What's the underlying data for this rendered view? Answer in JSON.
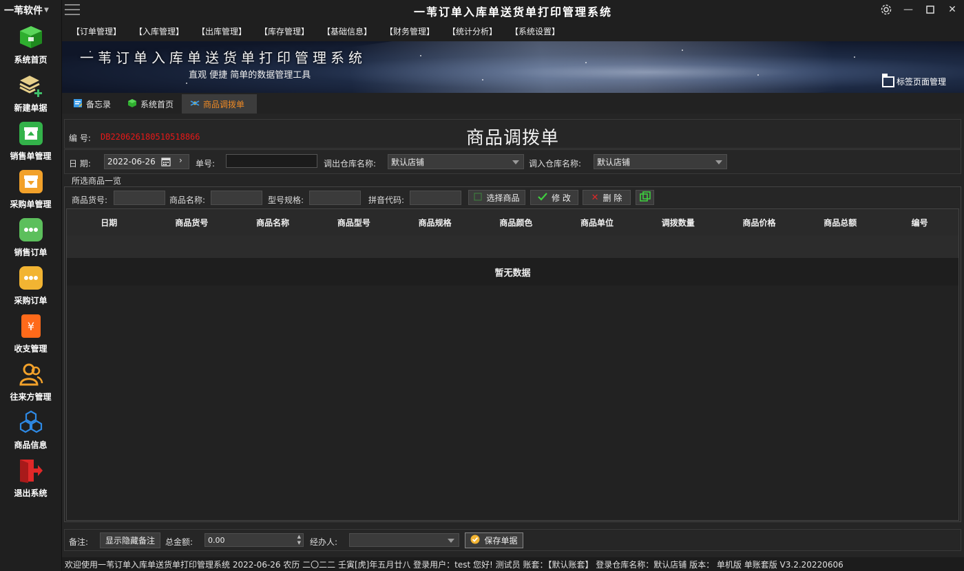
{
  "app": {
    "brand": "一苇软件",
    "title": "一苇订单入库单送货单打印管理系统"
  },
  "sidebar": {
    "items": [
      {
        "label": "系统首页",
        "icon": "green-box-icon",
        "color": "#3fbf3f"
      },
      {
        "label": "新建单据",
        "icon": "layers-plus-icon",
        "color": "#e0c070"
      },
      {
        "label": "销售单管理",
        "icon": "upload-box-icon",
        "color": "#3cb84a"
      },
      {
        "label": "采购单管理",
        "icon": "download-box-icon",
        "color": "#f0a020"
      },
      {
        "label": "销售订单",
        "icon": "chat-dots-icon",
        "color": "#5cc05c"
      },
      {
        "label": "采购订单",
        "icon": "chat-dots-icon",
        "color": "#f0b030"
      },
      {
        "label": "收支管理",
        "icon": "yen-icon",
        "color": "#ff6a1a"
      },
      {
        "label": "往来方管理",
        "icon": "users-icon",
        "color": "#f0a020"
      },
      {
        "label": "商品信息",
        "icon": "cubes-icon",
        "color": "#2e8ae6"
      },
      {
        "label": "退出系统",
        "icon": "exit-icon",
        "color": "#e02828"
      }
    ]
  },
  "menu": [
    "【订单管理】",
    "【入库管理】",
    "【出库管理】",
    "【库存管理】",
    "【基础信息】",
    "【财务管理】",
    "【统计分析】",
    "【系统设置】"
  ],
  "banner": {
    "title": "一苇订单入库单送货单打印管理系统",
    "subtitle": "直观 便捷 简单的数据管理工具",
    "tab_manager": "标签页面管理"
  },
  "tabs": [
    {
      "label": "备忘录",
      "icon": "memo-icon"
    },
    {
      "label": "系统首页",
      "icon": "green-box-icon"
    },
    {
      "label": "商品调拨单",
      "icon": "transfer-icon",
      "active": true
    }
  ],
  "form": {
    "code_label": "编 号:",
    "code_value": "DB220626180510518866",
    "title": "商品调拨单",
    "date_label": "日 期:",
    "date_value": "2022-06-26",
    "order_no_label": "单号:",
    "order_no_value": "",
    "out_wh_label": "调出仓库名称:",
    "out_wh_value": "默认店铺",
    "in_wh_label": "调入仓库名称:",
    "in_wh_value": "默认店铺"
  },
  "goods": {
    "group_title": "所选商品一览",
    "filters": {
      "sku_label": "商品货号:",
      "name_label": "商品名称:",
      "spec_label": "型号规格:",
      "pinyin_label": "拼音代码:"
    },
    "buttons": {
      "select": "选择商品",
      "edit": "修 改",
      "delete": "删 除"
    },
    "columns": [
      "日期",
      "商品货号",
      "商品名称",
      "商品型号",
      "商品规格",
      "商品颜色",
      "商品单位",
      "调拨数量",
      "商品价格",
      "商品总额",
      "编号"
    ],
    "empty_text": "暂无数据"
  },
  "footer": {
    "remark_label": "备注:",
    "toggle_remark": "显示隐藏备注",
    "total_label": "总金额:",
    "total_value": "0.00",
    "handler_label": "经办人:",
    "handler_value": "",
    "save": "保存单据"
  },
  "status": "欢迎使用一苇订单入库单送货单打印管理系统 2022-06-26 农历 二〇二二 壬寅[虎]年五月廿八 登录用户：test 您好! 测试员 账套：【默认账套】 登录仓库名称：默认店铺 版本：  单机版 单账套版 V3.2.20220606"
}
